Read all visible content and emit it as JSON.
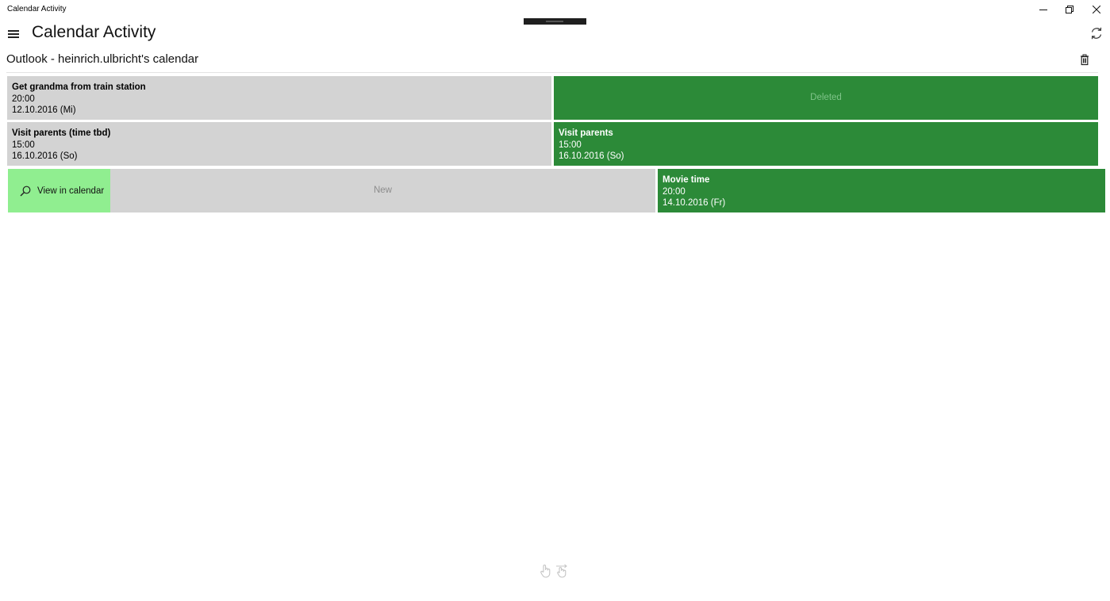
{
  "window": {
    "title": "Calendar Activity",
    "icons": {
      "minimize": "minimize-icon",
      "maximize": "restore-icon",
      "close": "close-icon"
    }
  },
  "header": {
    "title": "Calendar Activity",
    "menu_icon": "hamburger-icon",
    "sync_icon": "sync-icon"
  },
  "calendar": {
    "name": "Outlook - heinrich.ulbricht's calendar",
    "delete_icon": "trash-icon"
  },
  "rows": [
    {
      "left": {
        "title": "Get grandma from train station",
        "time": "20:00",
        "date": "12.10.2016 (Mi)"
      },
      "right": {
        "status": "Deleted"
      }
    },
    {
      "left": {
        "title": "Visit parents (time tbd)",
        "time": "15:00",
        "date": "16.10.2016 (So)"
      },
      "right": {
        "title": "Visit parents",
        "time": "15:00",
        "date": "16.10.2016 (So)"
      }
    },
    {
      "action": {
        "label": "View in calendar",
        "icon": "search-icon"
      },
      "left": {
        "status": "New"
      },
      "right": {
        "title": "Movie time",
        "time": "20:00",
        "date": "14.10.2016 (Fr)"
      }
    }
  ],
  "colors": {
    "old_tile": "#d3d3d3",
    "new_tile": "#2c8a38",
    "action_button": "#90ee90"
  },
  "footer": {
    "icons": [
      "touch-icon",
      "swipe-icon"
    ]
  }
}
